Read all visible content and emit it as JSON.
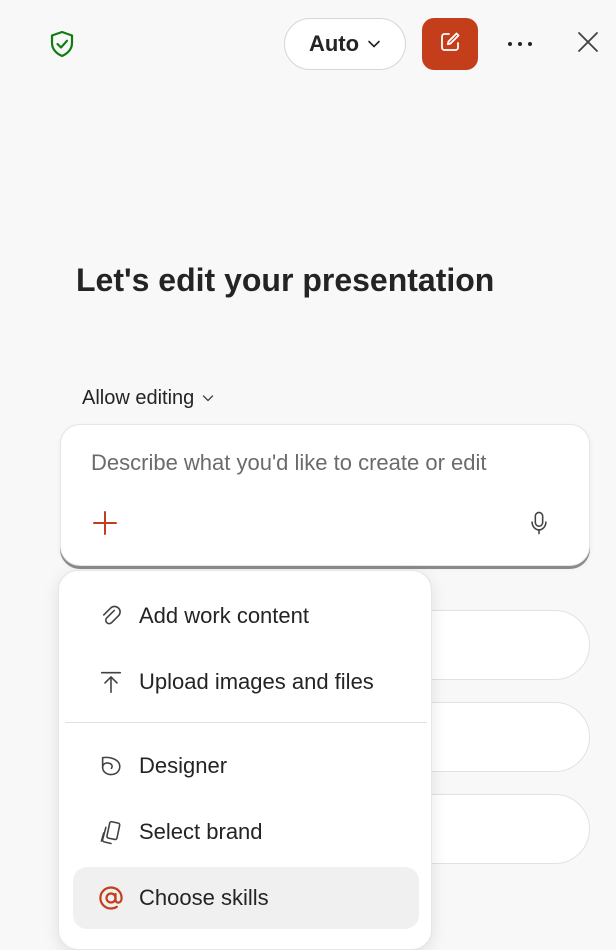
{
  "header": {
    "icons": {
      "shield": "shield-check-icon",
      "mode_chevron": "chevron-down-icon",
      "new_chat": "compose-icon",
      "more": "more-horizontal-icon",
      "close": "close-icon"
    },
    "mode_label": "Auto"
  },
  "main": {
    "title": "Let's edit your presentation",
    "allow_editing_label": "Allow editing"
  },
  "composer": {
    "placeholder": "Describe what you'd like to create or edit",
    "value": "",
    "icons": {
      "add": "plus-icon",
      "mic": "microphone-icon"
    }
  },
  "menu": {
    "items": [
      {
        "label": "Add work content",
        "icon": "paperclip-icon"
      },
      {
        "label": "Upload images and files",
        "icon": "upload-icon"
      },
      {
        "label": "Designer",
        "icon": "designer-icon"
      },
      {
        "label": "Select brand",
        "icon": "brand-icon"
      },
      {
        "label": "Choose skills",
        "icon": "at-sign-icon"
      }
    ]
  },
  "colors": {
    "accent": "#c43e1c",
    "shield": "#107c10",
    "background": "#f8f8f8"
  }
}
